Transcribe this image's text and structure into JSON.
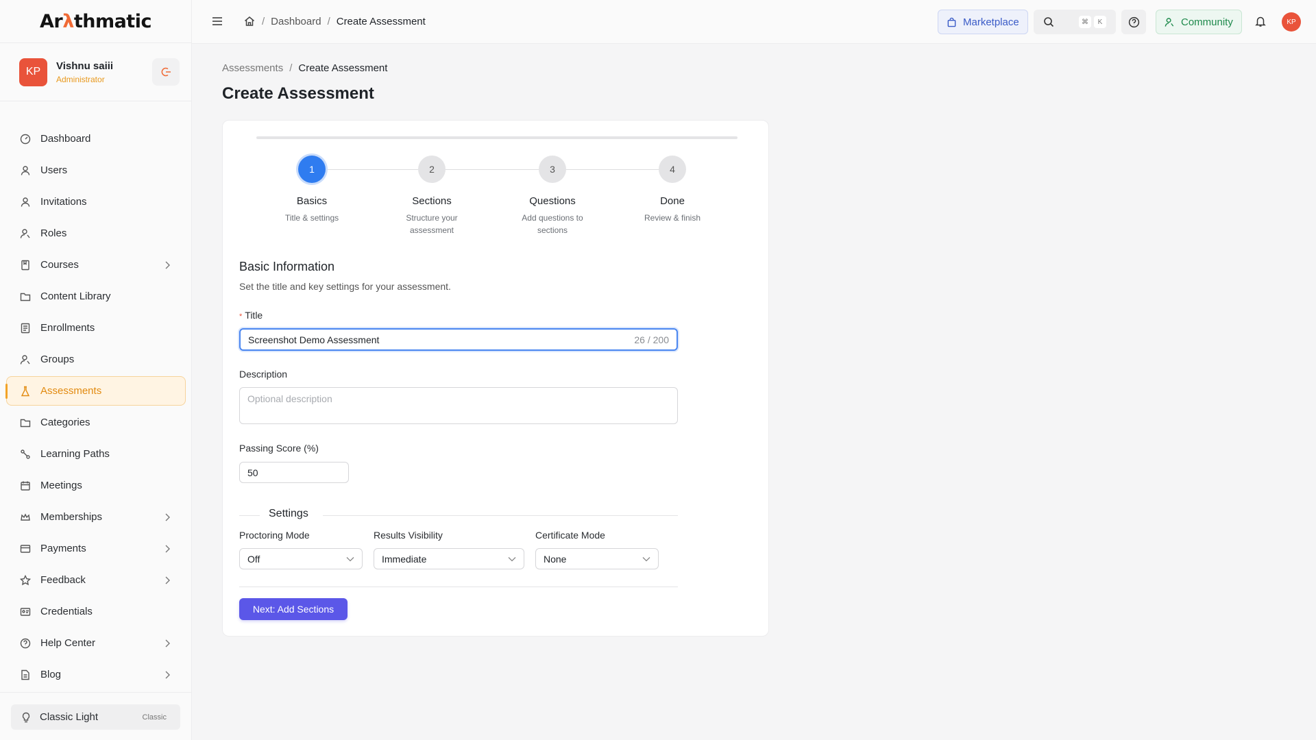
{
  "brand": {
    "name_prefix": "Ar",
    "name_accent": "λ",
    "name_suffix": "thmatic"
  },
  "user": {
    "initials": "KP",
    "name": "Vishnu saiii",
    "role": "Administrator"
  },
  "nav": [
    {
      "label": "Dashboard",
      "icon": "dashboard-icon",
      "chevron": false
    },
    {
      "label": "Users",
      "icon": "user-icon",
      "chevron": false
    },
    {
      "label": "Invitations",
      "icon": "invitation-icon",
      "chevron": false
    },
    {
      "label": "Roles",
      "icon": "roles-icon",
      "chevron": false
    },
    {
      "label": "Courses",
      "icon": "book-icon",
      "chevron": true
    },
    {
      "label": "Content Library",
      "icon": "folder-icon",
      "chevron": false
    },
    {
      "label": "Enrollments",
      "icon": "enrollment-icon",
      "chevron": false
    },
    {
      "label": "Groups",
      "icon": "groups-icon",
      "chevron": false
    },
    {
      "label": "Assessments",
      "icon": "flask-icon",
      "chevron": false,
      "active": true
    },
    {
      "label": "Categories",
      "icon": "folder-icon",
      "chevron": false
    },
    {
      "label": "Learning Paths",
      "icon": "path-icon",
      "chevron": false
    },
    {
      "label": "Meetings",
      "icon": "calendar-icon",
      "chevron": false
    },
    {
      "label": "Memberships",
      "icon": "crown-icon",
      "chevron": true
    },
    {
      "label": "Payments",
      "icon": "card-icon",
      "chevron": true
    },
    {
      "label": "Feedback",
      "icon": "star-icon",
      "chevron": true
    },
    {
      "label": "Credentials",
      "icon": "id-card-icon",
      "chevron": false
    },
    {
      "label": "Help Center",
      "icon": "help-icon",
      "chevron": true
    },
    {
      "label": "Blog",
      "icon": "document-icon",
      "chevron": true
    }
  ],
  "theme": {
    "label": "Classic Light",
    "tag": "Classic"
  },
  "header": {
    "crumbs": [
      "Dashboard",
      "Create Assessment"
    ],
    "marketplace": "Marketplace",
    "search_keys": [
      "⌘",
      "K"
    ],
    "community": "Community",
    "avatar_initials": "KP"
  },
  "page": {
    "crumbs": [
      "Assessments",
      "Create Assessment"
    ],
    "title": "Create Assessment"
  },
  "steps": [
    {
      "number": "1",
      "title": "Basics",
      "subtitle": "Title & settings",
      "active": true
    },
    {
      "number": "2",
      "title": "Sections",
      "subtitle": "Structure your assessment"
    },
    {
      "number": "3",
      "title": "Questions",
      "subtitle": "Add questions to sections"
    },
    {
      "number": "4",
      "title": "Done",
      "subtitle": "Review & finish"
    }
  ],
  "form": {
    "section_title": "Basic Information",
    "section_desc": "Set the title and key settings for your assessment.",
    "title_label": "Title",
    "title_value": "Screenshot Demo Assessment",
    "title_counter": "26 / 200",
    "description_label": "Description",
    "description_placeholder": "Optional description",
    "passing_label": "Passing Score (%)",
    "passing_value": "50",
    "settings_heading": "Settings",
    "proctoring_label": "Proctoring Mode",
    "proctoring_value": "Off",
    "results_label": "Results Visibility",
    "results_value": "Immediate",
    "certificate_label": "Certificate Mode",
    "certificate_value": "None",
    "next_button": "Next: Add Sections"
  },
  "colors": {
    "primary": "#5b57e8",
    "step_active": "#2f7cf0",
    "sidebar_active": "#e28a10",
    "avatar": "#e9533a"
  }
}
